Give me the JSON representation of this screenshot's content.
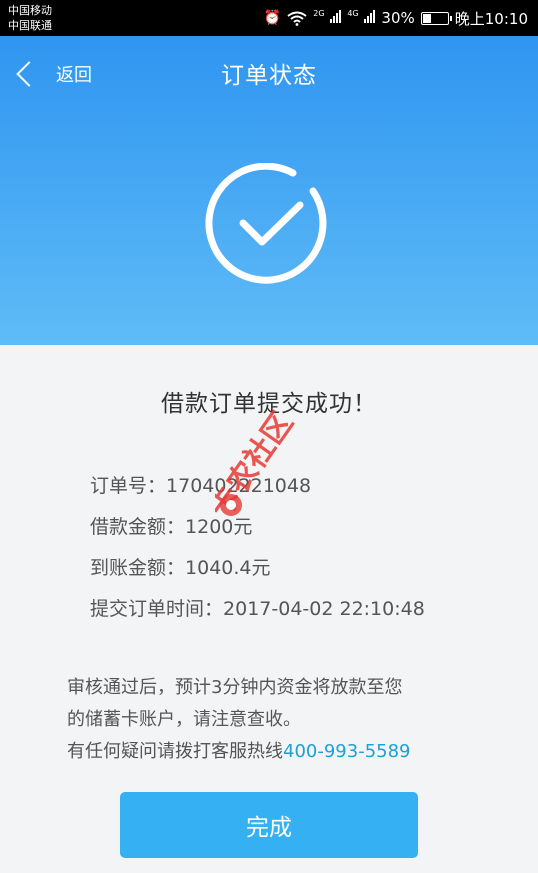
{
  "status_bar": {
    "carrier_1": "中国移动",
    "carrier_2": "中国联通",
    "net_1": "2G",
    "net_2": "4G",
    "battery": "30%",
    "time": "晚上10:10"
  },
  "nav": {
    "back_label": "返回",
    "title": "订单状态"
  },
  "result": {
    "title": "借款订单提交成功！"
  },
  "order_info": [
    {
      "label": "订单号：",
      "value": "170402221048"
    },
    {
      "label": "借款金额：",
      "value": "1200元"
    },
    {
      "label": "到账金额：",
      "value": "1040.4元"
    },
    {
      "label": "提交订单时间：",
      "value": "2017-04-02 22:10:48"
    }
  ],
  "notice": {
    "line_1": "审核通过后，预计3分钟内资金将放款至您",
    "line_2": "的储蓄卡账户，请注意查收。",
    "line_3_prefix": "有任何疑问请拨打客服热线",
    "hotline": "400-993-5589"
  },
  "done_button": "完成",
  "watermark": "卡农社区",
  "colors": {
    "header_top": "#2f95f0",
    "header_bottom": "#5fbcf7",
    "button": "#35b0f3",
    "hotline": "#1aa1d6",
    "watermark": "#e53935"
  }
}
